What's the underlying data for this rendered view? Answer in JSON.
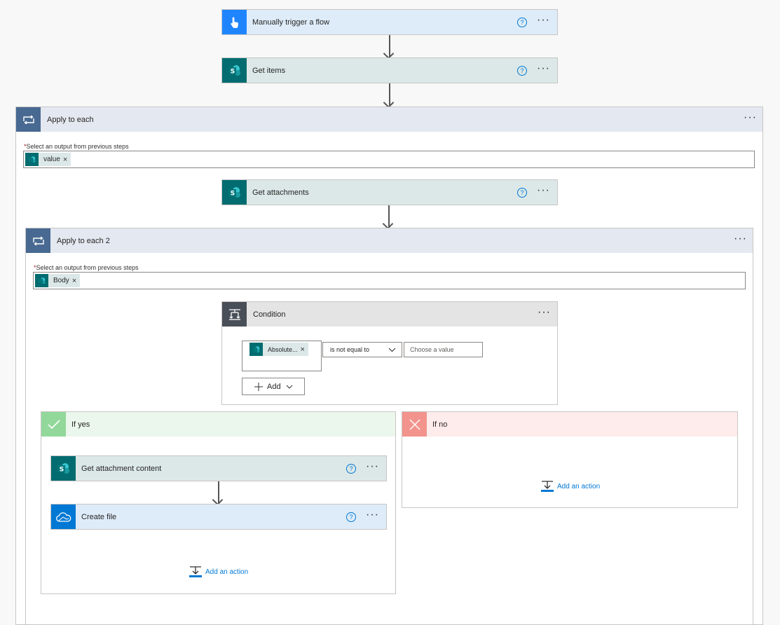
{
  "trigger": {
    "title": "Manually trigger a flow",
    "icon": "touch-icon"
  },
  "get_items": {
    "title": "Get items",
    "icon": "sharepoint-icon"
  },
  "apply_each": {
    "title": "Apply to each",
    "select_label": "Select an output from previous steps",
    "token": "value"
  },
  "get_attachments": {
    "title": "Get attachments"
  },
  "apply_each_2": {
    "title": "Apply to each 2",
    "select_label": "Select an output from previous steps",
    "token": "Body"
  },
  "condition": {
    "title": "Condition",
    "left_token": "Absolute...",
    "operator": "is not equal to",
    "value_placeholder": "Choose a value",
    "add_label": "Add"
  },
  "if_yes": {
    "title": "If yes",
    "actions": [
      "Get attachment content",
      "Create file"
    ],
    "add_action": "Add an action"
  },
  "if_no": {
    "title": "If no",
    "add_action": "Add an action"
  },
  "help_glyph": "?",
  "dots_glyph": "···",
  "remove_glyph": "×",
  "colors": {
    "trigger_blue": "#1f85ff",
    "sharepoint_teal": "#036c70",
    "loop_slate": "#486991",
    "yes_green": "#92d89b",
    "no_red": "#f2948d",
    "link_blue": "#0078d4"
  }
}
